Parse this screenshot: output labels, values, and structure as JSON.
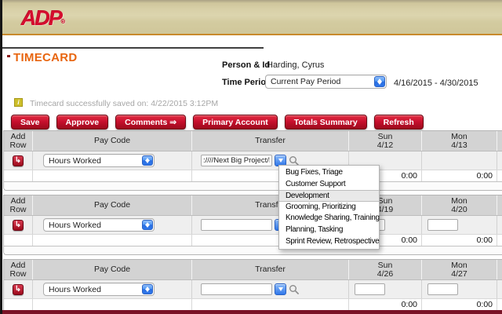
{
  "brand": {
    "logo_text": "ADP",
    "registered_mark": "®"
  },
  "page": {
    "title": "TIMECARD"
  },
  "person": {
    "label": "Person & Id",
    "value": "Harding, Cyrus"
  },
  "time_period": {
    "label": "Time Period",
    "selected": "Current Pay Period",
    "date_range": "4/16/2015 - 4/30/2015"
  },
  "status": {
    "icon_glyph": "i",
    "message": "Timecard successfully saved on: 4/22/2015 3:12PM"
  },
  "toolbar": {
    "buttons": [
      "Save",
      "Approve",
      "Comments ⇒",
      "Primary Account",
      "Totals Summary",
      "Refresh"
    ]
  },
  "icons": {
    "add_row_glyph": "↳"
  },
  "timecard": {
    "column_headers": {
      "add_row": "Add Row",
      "pay_code": "Pay Code",
      "transfer": "Transfer"
    },
    "sections": [
      {
        "days": [
          {
            "dow": "Sun",
            "date": "4/12"
          },
          {
            "dow": "Mon",
            "date": "4/13"
          }
        ],
        "pay_code": "Hours Worked",
        "transfer_value": ":////Next Big Project/De",
        "totals": [
          "0:00",
          "0:00"
        ]
      },
      {
        "days": [
          {
            "dow": "Sun",
            "date": "4/19"
          },
          {
            "dow": "Mon",
            "date": "4/20"
          }
        ],
        "pay_code": "Hours Worked",
        "transfer_value": "",
        "totals": [
          "0:00",
          "0:00"
        ]
      },
      {
        "days": [
          {
            "dow": "Sun",
            "date": "4/26"
          },
          {
            "dow": "Mon",
            "date": "4/27"
          }
        ],
        "pay_code": "Hours Worked",
        "transfer_value": "",
        "totals": [
          "0:00",
          "0:00"
        ]
      }
    ]
  },
  "transfer_dropdown": {
    "highlighted_item": "Development",
    "items": [
      "Bug Fixes, Triage",
      "Customer Support",
      "Development",
      "Grooming, Prioritizing",
      "Knowledge Sharing, Training",
      "Planning, Tasking",
      "Sprint Review, Retrospective"
    ]
  },
  "colors": {
    "header_tan": "#d3cba0",
    "rule_orange": "#c98a2c",
    "button_red": "#c8102e",
    "title_orange": "#e8650f",
    "brand_red": "#d40e2e",
    "bottom_maroon": "#7a1326",
    "table_header_gray": "#d3d3d3"
  }
}
